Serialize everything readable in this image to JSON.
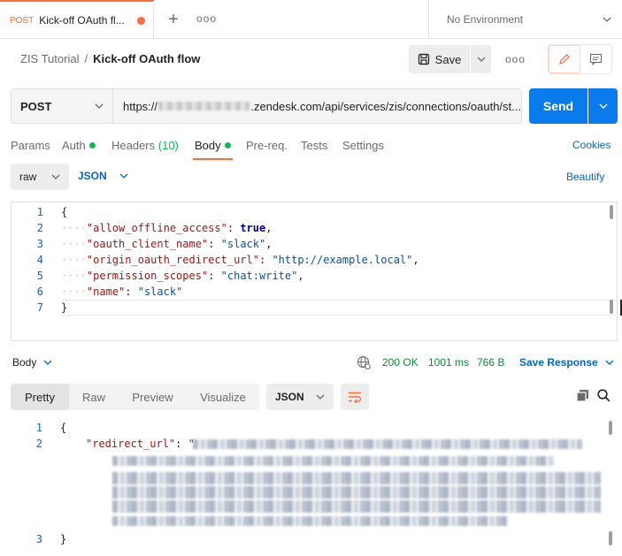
{
  "tabs": {
    "active": {
      "method": "POST",
      "title": "Kick-off OAuth fl..."
    },
    "environment": "No Environment"
  },
  "breadcrumb": {
    "parent": "ZIS Tutorial",
    "separator": "/",
    "current": "Kick-off OAuth flow"
  },
  "toolbar": {
    "save_label": "Save"
  },
  "request": {
    "method": "POST",
    "url_prefix": "https://",
    "url_suffix": ".zendesk.com/api/services/zis/connections/oauth/st...",
    "send_label": "Send"
  },
  "req_tabs": {
    "params": "Params",
    "auth": "Auth",
    "headers": "Headers",
    "headers_count": "(10)",
    "body": "Body",
    "prereq": "Pre-req.",
    "tests": "Tests",
    "settings": "Settings",
    "cookies": "Cookies"
  },
  "body_format": {
    "mode": "raw",
    "language": "JSON",
    "beautify": "Beautify"
  },
  "request_body": {
    "line_numbers": [
      "1",
      "2",
      "3",
      "4",
      "5",
      "6",
      "7"
    ],
    "open": "{",
    "close": "}",
    "entries": [
      {
        "key": "\"allow_offline_access\"",
        "value": "true",
        "comma": ","
      },
      {
        "key": "\"oauth_client_name\"",
        "value": "\"slack\"",
        "comma": ","
      },
      {
        "key": "\"origin_oauth_redirect_url\"",
        "value": "\"http://example.local\"",
        "comma": ","
      },
      {
        "key": "\"permission_scopes\"",
        "value": "\"chat:write\"",
        "comma": ","
      },
      {
        "key": "\"name\"",
        "value": "\"slack\"",
        "comma": ""
      }
    ]
  },
  "response": {
    "body_label": "Body",
    "status": "200 OK",
    "time": "1001 ms",
    "size": "766 B",
    "save_response": "Save Response",
    "views": [
      "Pretty",
      "Raw",
      "Preview",
      "Visualize"
    ],
    "active_view": "Pretty",
    "format": "JSON",
    "line_numbers": [
      "1",
      "2",
      "3"
    ],
    "open": "{",
    "close": "}",
    "key": "\"redirect_url\"",
    "value_prefix": "\""
  },
  "colors": {
    "accent": "#ff6c37",
    "primary": "#097bed",
    "link": "#0265d2",
    "success": "#0cbb52"
  },
  "icons": [
    "plus-icon",
    "more-icon",
    "chevron-down-icon",
    "save-icon",
    "pencil-icon",
    "comment-icon",
    "globe-icon",
    "wrap-icon",
    "copy-icon",
    "search-icon"
  ]
}
